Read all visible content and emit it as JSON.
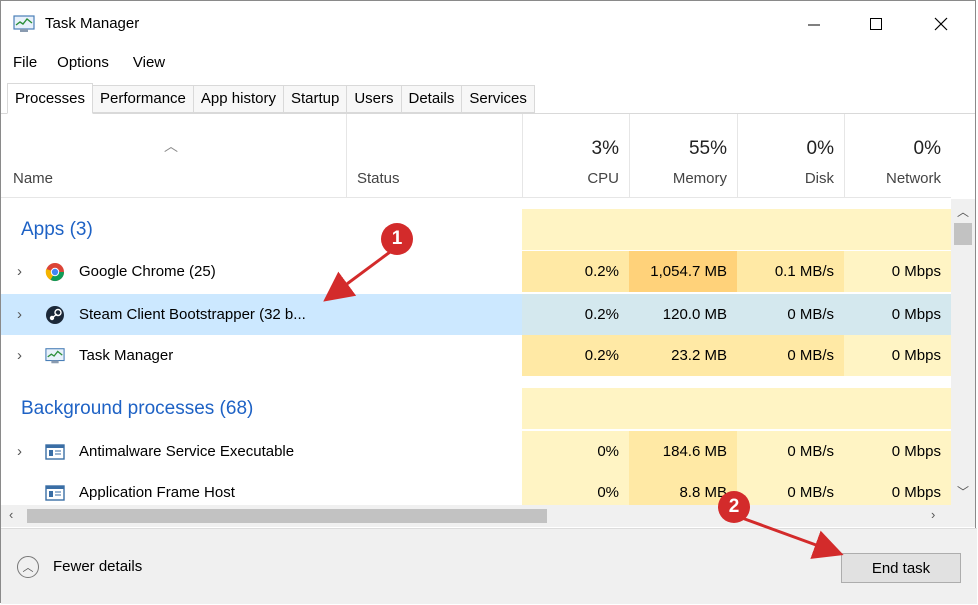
{
  "window": {
    "title": "Task Manager"
  },
  "menu": [
    "File",
    "Options",
    "View"
  ],
  "tabs": [
    "Processes",
    "Performance",
    "App history",
    "Startup",
    "Users",
    "Details",
    "Services"
  ],
  "columns": {
    "name": "Name",
    "status": "Status",
    "cpu": {
      "pct": "3%",
      "label": "CPU"
    },
    "memory": {
      "pct": "55%",
      "label": "Memory"
    },
    "disk": {
      "pct": "0%",
      "label": "Disk"
    },
    "network": {
      "pct": "0%",
      "label": "Network"
    }
  },
  "groups": {
    "apps": "Apps (3)",
    "background": "Background processes (68)"
  },
  "rows": [
    {
      "name": "Google Chrome (25)",
      "cpu": "0.2%",
      "memory": "1,054.7 MB",
      "disk": "0.1 MB/s",
      "network": "0 Mbps"
    },
    {
      "name": "Steam Client Bootstrapper (32 b...",
      "cpu": "0.2%",
      "memory": "120.0 MB",
      "disk": "0 MB/s",
      "network": "0 Mbps"
    },
    {
      "name": "Task Manager",
      "cpu": "0.2%",
      "memory": "23.2 MB",
      "disk": "0 MB/s",
      "network": "0 Mbps"
    },
    {
      "name": "Antimalware Service Executable",
      "cpu": "0%",
      "memory": "184.6 MB",
      "disk": "0 MB/s",
      "network": "0 Mbps"
    },
    {
      "name": "Application Frame Host",
      "cpu": "0%",
      "memory": "8.8 MB",
      "disk": "0 MB/s",
      "network": "0 Mbps"
    }
  ],
  "footer": {
    "fewer_details": "Fewer details",
    "end_task": "End task"
  },
  "annotations": {
    "step1": "1",
    "step2": "2",
    "color": "#d32b2b"
  },
  "colors": {
    "accent": "#1e62c5",
    "selected": "#cce8ff",
    "heat_light": "#fff4c4",
    "heat_strong": "#ffd27a"
  }
}
